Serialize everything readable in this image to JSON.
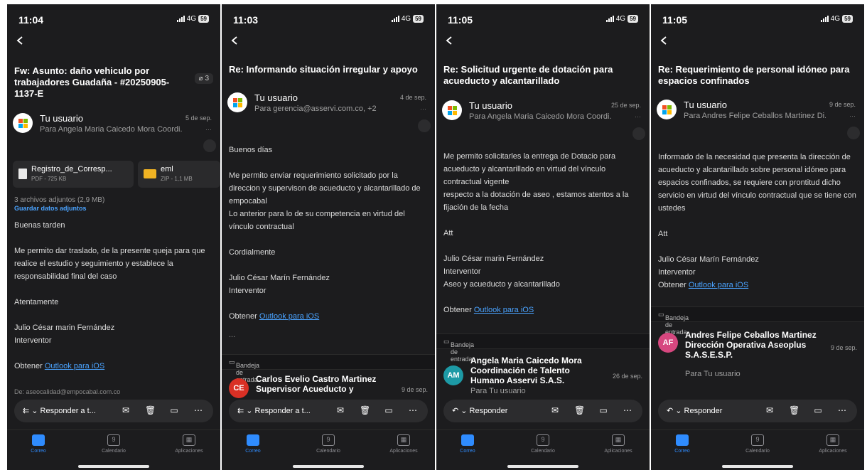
{
  "screens": [
    {
      "time": "11:04",
      "network": "4G",
      "battery": "59",
      "subject": "Fw: Asunto: daño vehiculo por trabajadores Guadaña - #20250905-1137-E",
      "attachment_badge": "3",
      "from": "Tu usuario",
      "to": "Para Angela Maria Caicedo Mora Coordi...",
      "date": "5 de sep.",
      "attachments": [
        {
          "name": "Registro_de_Corresp...",
          "meta": "PDF - 725 KB"
        },
        {
          "name": "eml",
          "meta": "ZIP - 1,1 MB"
        }
      ],
      "attach_count": "3 archivos adjuntos (2,9 MB)",
      "attach_save": "Guardar datos adjuntos",
      "body": {
        "l1": "Buenas tarden",
        "l2": "Me permito dar traslado, de la presente queja para que realice el estudio y seguimiento y establece la responsabilidad final del caso",
        "l3": "Atentamente",
        "l4": "Julio César marin Fernández",
        "l5": "Interventor",
        "l6": "Obtener ",
        "link": "Outlook para iOS",
        "l7": "De: aseocalidad@empocabal.com.co"
      },
      "reply_label": "Responder a t..."
    },
    {
      "time": "11:03",
      "network": "4G",
      "battery": "59",
      "subject": "Re: Informando situación irregular y apoyo",
      "from": "Tu usuario",
      "to": "Para gerencia@asservi.com.co, +2",
      "date": "4 de sep.",
      "body": {
        "l1": "Buenos días",
        "l2": "Me permito enviar requerimiento solicitado por la direccion y supervison de acueducto y alcantarillado de empocabal",
        "l3": "Lo anterior para lo de su competencia en virtud del vínculo contractual",
        "l4": "Cordialmente",
        "l5": "Julio César Marín Fernández",
        "l6": "Interventor",
        "l7": "Obtener ",
        "link": "Outlook para iOS",
        "ellipsis": "..."
      },
      "inbox_label": "Bandeja de entrada",
      "next": {
        "initials": "CE",
        "name": "Carlos Evelio Castro Martinez",
        "role": "Supervisor Acueducto y",
        "date": "9 de sep."
      },
      "reply_label": "Responder a t..."
    },
    {
      "time": "11:05",
      "network": "4G",
      "battery": "59",
      "subject": "Re: Solicitud urgente de dotación para acueducto y alcantarillado",
      "from": "Tu usuario",
      "to": "Para Angela Maria Caicedo Mora Coordi...",
      "date": "25 de sep.",
      "body": {
        "l1": "Me permito solicitarles la entrega de Dotacio para acueducto y alcantarillado en virtud del vínculo contractual vigente",
        "l2": "respecto a la dotación de aseo , estamos atentos a la fijación de la fecha",
        "l3": "Att",
        "l4": "Julio César marin Fernández",
        "l5": "Interventor",
        "l6": "Aseo y acueducto y alcantarillado",
        "l7": "Obtener ",
        "link": "Outlook para iOS"
      },
      "inbox_label": "Bandeja de entrada",
      "next": {
        "initials": "AM",
        "name": "Angela Maria Caicedo Mora Coordinación de Talento Humano Asservi S.A.S.",
        "date": "26 de sep.",
        "to": "Para Tu usuario"
      },
      "reply_label": "Responder"
    },
    {
      "time": "11:05",
      "network": "4G",
      "battery": "59",
      "subject": "Re: Requerimiento de personal idóneo para espacios confinados",
      "from": "Tu usuario",
      "to": "Para Andres Felipe Ceballos Martinez Di...",
      "date": "9 de sep.",
      "body": {
        "l1": "Informado de la necesidad que presenta la dirección de acueducto y alcantarillado sobre personal idóneo para espacios confinados, se requiere con prontitud dicho servicio en virtud del vínculo contractual que se tiene con ustedes",
        "l2": "Att",
        "l3": "Julio César Marín Fernández",
        "l4": "Interventor",
        "l5": "Obtener ",
        "link": "Outlook para iOS"
      },
      "inbox_label": "Bandeja de entrada",
      "next": {
        "initials": "AF",
        "name": "Andres Felipe Ceballos Martinez Dirección Operativa Aseoplus S.A.S.E.S.P.",
        "date": "9 de sep.",
        "to": "Para Tu usuario"
      },
      "reply_label": "Responder"
    }
  ],
  "tabs": {
    "mail": "Correo",
    "calendar": "Calendario",
    "calendar_day": "9",
    "apps": "Aplicaciones"
  },
  "colors": {
    "accent": "#2f8cff",
    "background": "#1c1c1e",
    "link": "#4aa3ff",
    "avatar_ce": "#d93025",
    "avatar_am": "#1d9aa6",
    "avatar_af": "#d6477f"
  },
  "icons": [
    "back-chevron-icon",
    "paperclip-icon",
    "reply-icon",
    "mark-unread-icon",
    "delete-icon",
    "archive-icon",
    "more-icon",
    "mail-icon",
    "calendar-icon",
    "apps-icon",
    "inbox-icon"
  ]
}
